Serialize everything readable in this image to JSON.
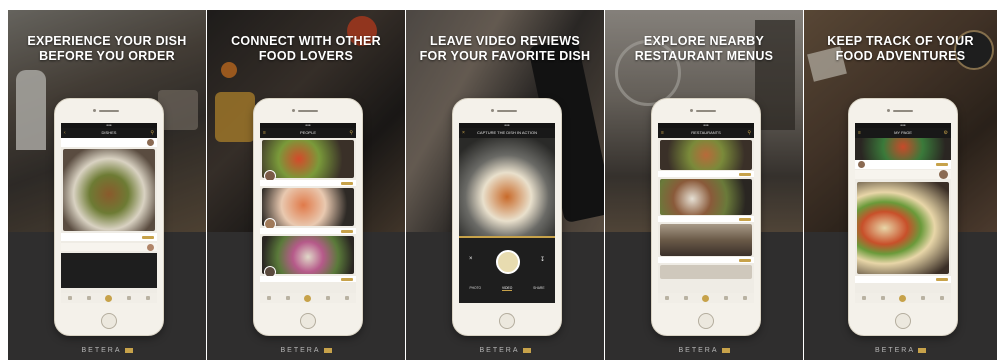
{
  "panels": [
    {
      "headline": [
        "EXPERIENCE YOUR DISH",
        "BEFORE YOU ORDER"
      ],
      "screen_title": "DISHES",
      "brand": "BETERA",
      "colors": {
        "photo": "#4b4038",
        "accent": "#c7a24a"
      }
    },
    {
      "headline": [
        "CONNECT WITH OTHER",
        "FOOD LOVERS"
      ],
      "screen_title": "PEOPLE",
      "brand": "BETERA",
      "colors": {
        "photo": "#3a3430",
        "accent": "#c7a24a"
      }
    },
    {
      "headline": [
        "LEAVE VIDEO REVIEWS",
        "FOR YOUR FAVORITE DISH"
      ],
      "screen_title": "CAPTURE THE DISH IN ACTION",
      "modes": [
        "PHOTO",
        "VIDEO",
        "SHARE"
      ],
      "brand": "BETERA",
      "colors": {
        "photo": "#5a524c",
        "accent": "#c7a24a"
      }
    },
    {
      "headline": [
        "EXPLORE NEARBY",
        "RESTAURANT MENUS"
      ],
      "screen_title": "RESTAURANTS",
      "brand": "BETERA",
      "colors": {
        "photo": "#6e6862",
        "accent": "#c7a24a"
      }
    },
    {
      "headline": [
        "KEEP TRACK OF YOUR",
        "FOOD ADVENTURES"
      ],
      "screen_title": "MY PAGE",
      "brand": "BETERA",
      "colors": {
        "photo": "#4a3a2e",
        "accent": "#c7a24a"
      }
    }
  ]
}
